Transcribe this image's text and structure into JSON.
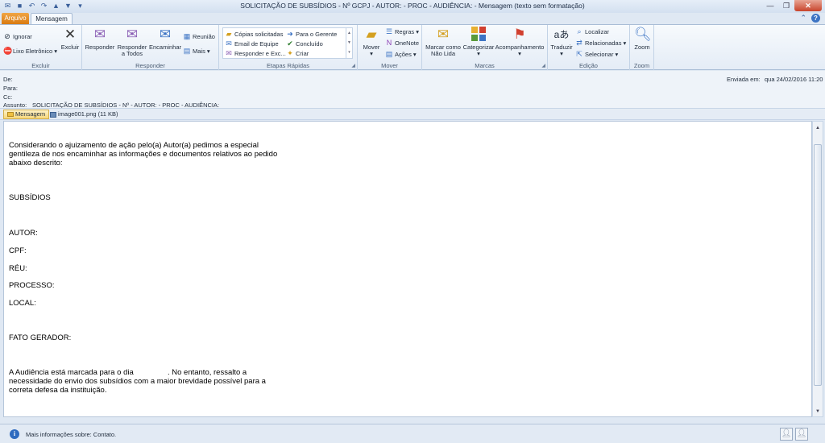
{
  "window": {
    "title": "SOLICITAÇÃO DE SUBSÍDIOS - Nº GCPJ  - AUTOR:  - PROC  - AUDIÊNCIA:  - Mensagem (texto sem formatação)"
  },
  "tabs": {
    "file": "Arquivo",
    "message": "Mensagem"
  },
  "ribbon": {
    "excluir": {
      "label": "Excluir",
      "ignore": "Ignorar",
      "junk": "Lixo Eletrônico",
      "delete": "Excluir"
    },
    "responder": {
      "label": "Responder",
      "reply": "Responder",
      "reply_all_1": "Responder",
      "reply_all_2": "a Todos",
      "forward": "Encaminhar",
      "meeting": "Reunião",
      "more": "Mais"
    },
    "quicksteps": {
      "label": "Etapas Rápidas",
      "items": [
        "Cópias solicitadas",
        "Email de Equipe",
        "Responder e Exc...",
        "Para o Gerente",
        "Concluído",
        "Criar"
      ]
    },
    "mover": {
      "label": "Mover",
      "move": "Mover",
      "rules": "Regras",
      "onenote": "OneNote",
      "actions": "Ações"
    },
    "marcas": {
      "label": "Marcas",
      "unread_1": "Marcar como",
      "unread_2": "Não Lida",
      "categorize": "Categorizar",
      "followup": "Acompanhamento"
    },
    "edicao": {
      "label": "Edição",
      "translate": "Traduzir",
      "find": "Localizar",
      "related": "Relacionadas",
      "select": "Selecionar"
    },
    "zoom": {
      "label": "Zoom",
      "zoom": "Zoom"
    }
  },
  "header": {
    "from_label": "De:",
    "to_label": "Para:",
    "cc_label": "Cc:",
    "subject_label": "Assunto:",
    "subject_value": "SOLICITAÇÃO DE SUBSÍDIOS - Nº              - AUTOR: - PROC  - AUDIÊNCIA:",
    "sent_label": "Enviada em:",
    "sent_value": "qua 24/02/2016 11:20"
  },
  "attachments": {
    "message": "Mensagem",
    "image": "image001.png (11 KB)"
  },
  "body": {
    "p1_l1": "Considerando o ajuizamento de ação pelo(a) Autor(a) pedimos a especial",
    "p1_l2": "gentileza de nos encaminhar as informações e documentos relativos ao pedido",
    "p1_l3": "abaixo descrito:",
    "subsidios": "SUBSÍDIOS",
    "autor": "AUTOR:",
    "cpf": "CPF:",
    "reu": "RÉU:",
    "processo": "PROCESSO:",
    "local": "LOCAL:",
    "fato": "FATO GERADOR:",
    "p2_l1": "A Audiência está marcada para o dia                . No entanto, ressalto a",
    "p2_l2": "necessidade do envio dos subsídios com a maior brevidade possível para a",
    "p2_l3": "correta defesa da instituição."
  },
  "status": {
    "text": "Mais informações sobre: Contato."
  },
  "colors": {
    "file_tab": "#d97a10",
    "close_button": "#c8432b",
    "info_icon": "#2e6bbf"
  }
}
